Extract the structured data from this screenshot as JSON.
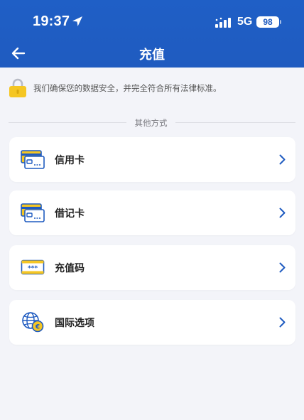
{
  "status_bar": {
    "time": "19:37",
    "network": "5G",
    "battery": "98",
    "icons": [
      "location-arrow-icon",
      "signal-icon"
    ]
  },
  "nav": {
    "back_icon": "arrow-left-icon",
    "title": "充值"
  },
  "notice": {
    "icon": "lock-icon",
    "text": "我们确保您的数据安全，并完全符合所有法律标准。"
  },
  "section": {
    "label": "其他方式"
  },
  "options": [
    {
      "label": "信用卡",
      "icon": "credit-card-icon"
    },
    {
      "label": "借记卡",
      "icon": "debit-card-icon"
    },
    {
      "label": "充值码",
      "icon": "voucher-code-icon"
    },
    {
      "label": "国际选项",
      "icon": "international-globe-icon"
    }
  ],
  "colors": {
    "header_blue": "#1f5bc0",
    "accent_blue": "#1f5bc0",
    "card_yellow": "#f5c623",
    "background": "#f3f4f9"
  }
}
